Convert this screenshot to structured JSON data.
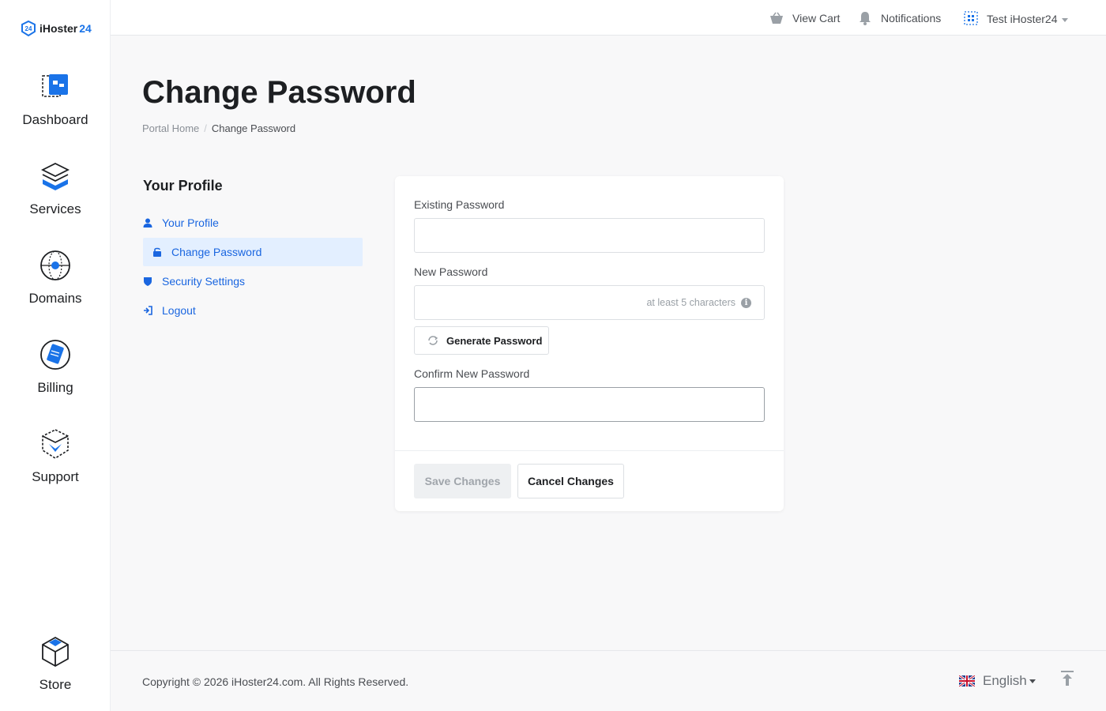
{
  "brand": {
    "name": "iHoster",
    "suffix": "24",
    "accent": "#1a73e8"
  },
  "sidebar": {
    "items": [
      {
        "label": "Dashboard",
        "icon": "dashboard-icon"
      },
      {
        "label": "Services",
        "icon": "services-icon"
      },
      {
        "label": "Domains",
        "icon": "globe-icon"
      },
      {
        "label": "Billing",
        "icon": "billing-icon"
      },
      {
        "label": "Support",
        "icon": "support-icon"
      },
      {
        "label": "Store",
        "icon": "cube-icon"
      }
    ]
  },
  "topbar": {
    "cart": "View Cart",
    "notifications": "Notifications",
    "account": "Test iHoster24"
  },
  "page": {
    "title": "Change Password",
    "breadcrumb": {
      "home": "Portal Home",
      "current": "Change Password"
    }
  },
  "profile_menu": {
    "title": "Your Profile",
    "items": [
      {
        "label": "Your Profile",
        "icon": "user-icon"
      },
      {
        "label": "Change Password",
        "icon": "lock-icon",
        "active": true
      },
      {
        "label": "Security Settings",
        "icon": "shield-icon"
      },
      {
        "label": "Logout",
        "icon": "logout-icon"
      }
    ]
  },
  "form": {
    "existing_label": "Existing Password",
    "existing_value": "",
    "new_label": "New Password",
    "new_placeholder": "at least 5 characters",
    "new_value": "",
    "generate_label": "Generate Password",
    "confirm_label": "Confirm New Password",
    "confirm_value": "",
    "save_label": "Save Changes",
    "cancel_label": "Cancel Changes"
  },
  "footer": {
    "copyright": "Copyright © 2026 iHoster24.com. All Rights Reserved.",
    "language": "English"
  }
}
